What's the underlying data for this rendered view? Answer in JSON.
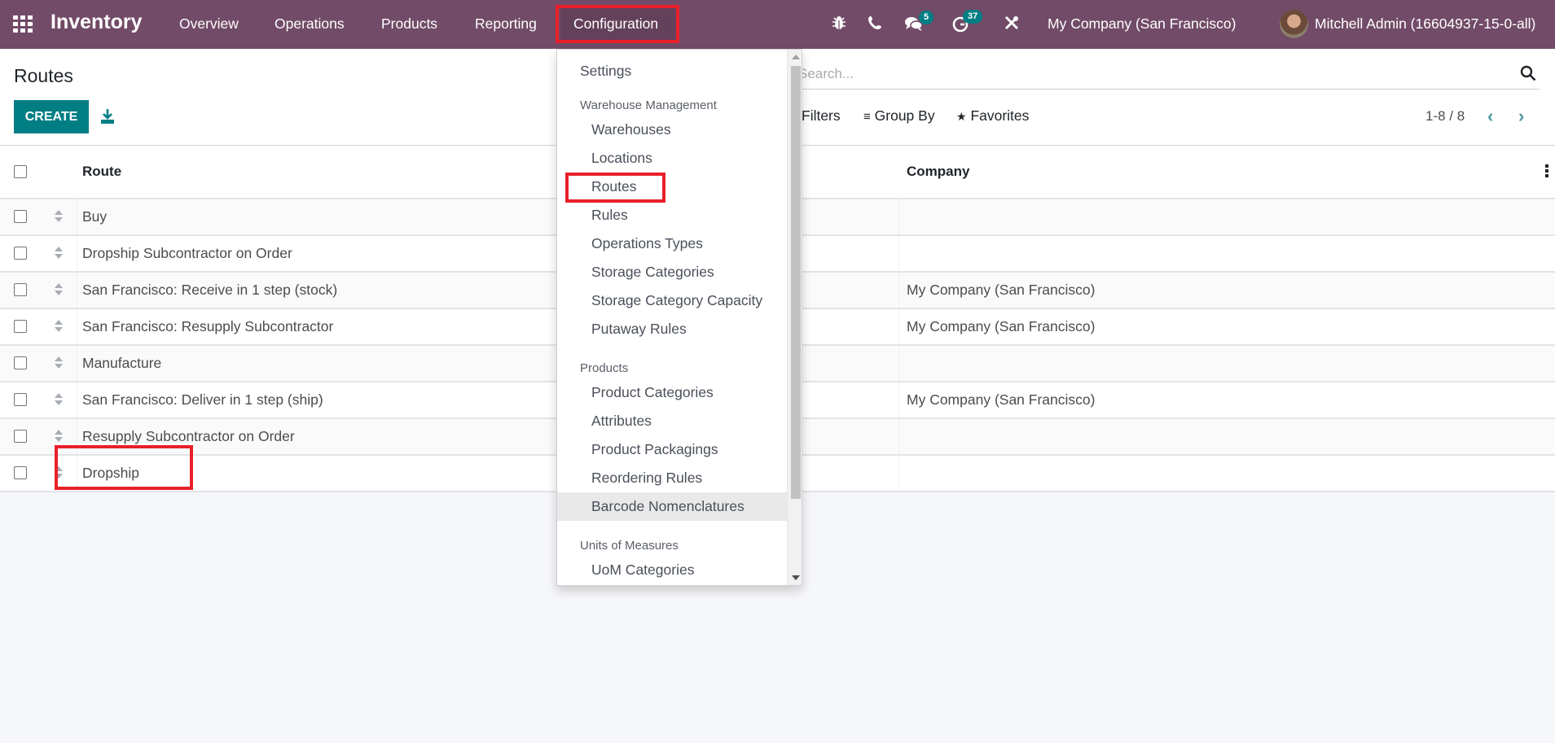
{
  "navbar": {
    "app_switcher_icon": "grid-icon",
    "brand": "Inventory",
    "menus": [
      "Overview",
      "Operations",
      "Products",
      "Reporting",
      "Configuration"
    ],
    "active_menu": "Configuration",
    "systray": {
      "debug_icon": "bug-icon",
      "phone_icon": "phone-icon",
      "messages_icon": "comments-icon",
      "messages_count": "5",
      "activities_icon": "clock-icon",
      "activities_count": "37",
      "settings_icon": "tools-icon"
    },
    "company": "My Company (San Francisco)",
    "user": "Mitchell Admin (16604937-15-0-all)"
  },
  "control_panel": {
    "title": "Routes",
    "create_label": "CREATE",
    "download_icon": "download-icon",
    "search_placeholder": "Search...",
    "filters_label": "Filters",
    "group_by_label": "Group By",
    "favorites_label": "Favorites",
    "pager_value": "1-8 / 8"
  },
  "table": {
    "columns": [
      "Route",
      "Company"
    ],
    "rows": [
      {
        "route": "Buy",
        "company": ""
      },
      {
        "route": "Dropship Subcontractor on Order",
        "company": ""
      },
      {
        "route": "San Francisco: Receive in 1 step (stock)",
        "company": "My Company (San Francisco)"
      },
      {
        "route": "San Francisco: Resupply Subcontractor",
        "company": "My Company (San Francisco)"
      },
      {
        "route": "Manufacture",
        "company": ""
      },
      {
        "route": "San Francisco: Deliver in 1 step (ship)",
        "company": "My Company (San Francisco)"
      },
      {
        "route": "Resupply Subcontractor on Order",
        "company": ""
      },
      {
        "route": "Dropship",
        "company": ""
      }
    ]
  },
  "dropdown": {
    "settings": "Settings",
    "sections": [
      {
        "header": "Warehouse Management",
        "items": [
          "Warehouses",
          "Locations",
          "Routes",
          "Rules",
          "Operations Types",
          "Storage Categories",
          "Storage Category Capacity",
          "Putaway Rules"
        ]
      },
      {
        "header": "Products",
        "items": [
          "Product Categories",
          "Attributes",
          "Product Packagings",
          "Reordering Rules",
          "Barcode Nomenclatures"
        ]
      },
      {
        "header": "Units of Measures",
        "items": [
          "UoM Categories"
        ]
      }
    ],
    "hovered_item": "Barcode Nomenclatures",
    "highlighted_item": "Routes"
  },
  "annotations": {
    "highlighted": [
      "Configuration",
      "Routes",
      "Dropship"
    ],
    "highlight_color": "#e8202a"
  },
  "colors": {
    "brand": "#714B67",
    "primary": "#017e84"
  }
}
